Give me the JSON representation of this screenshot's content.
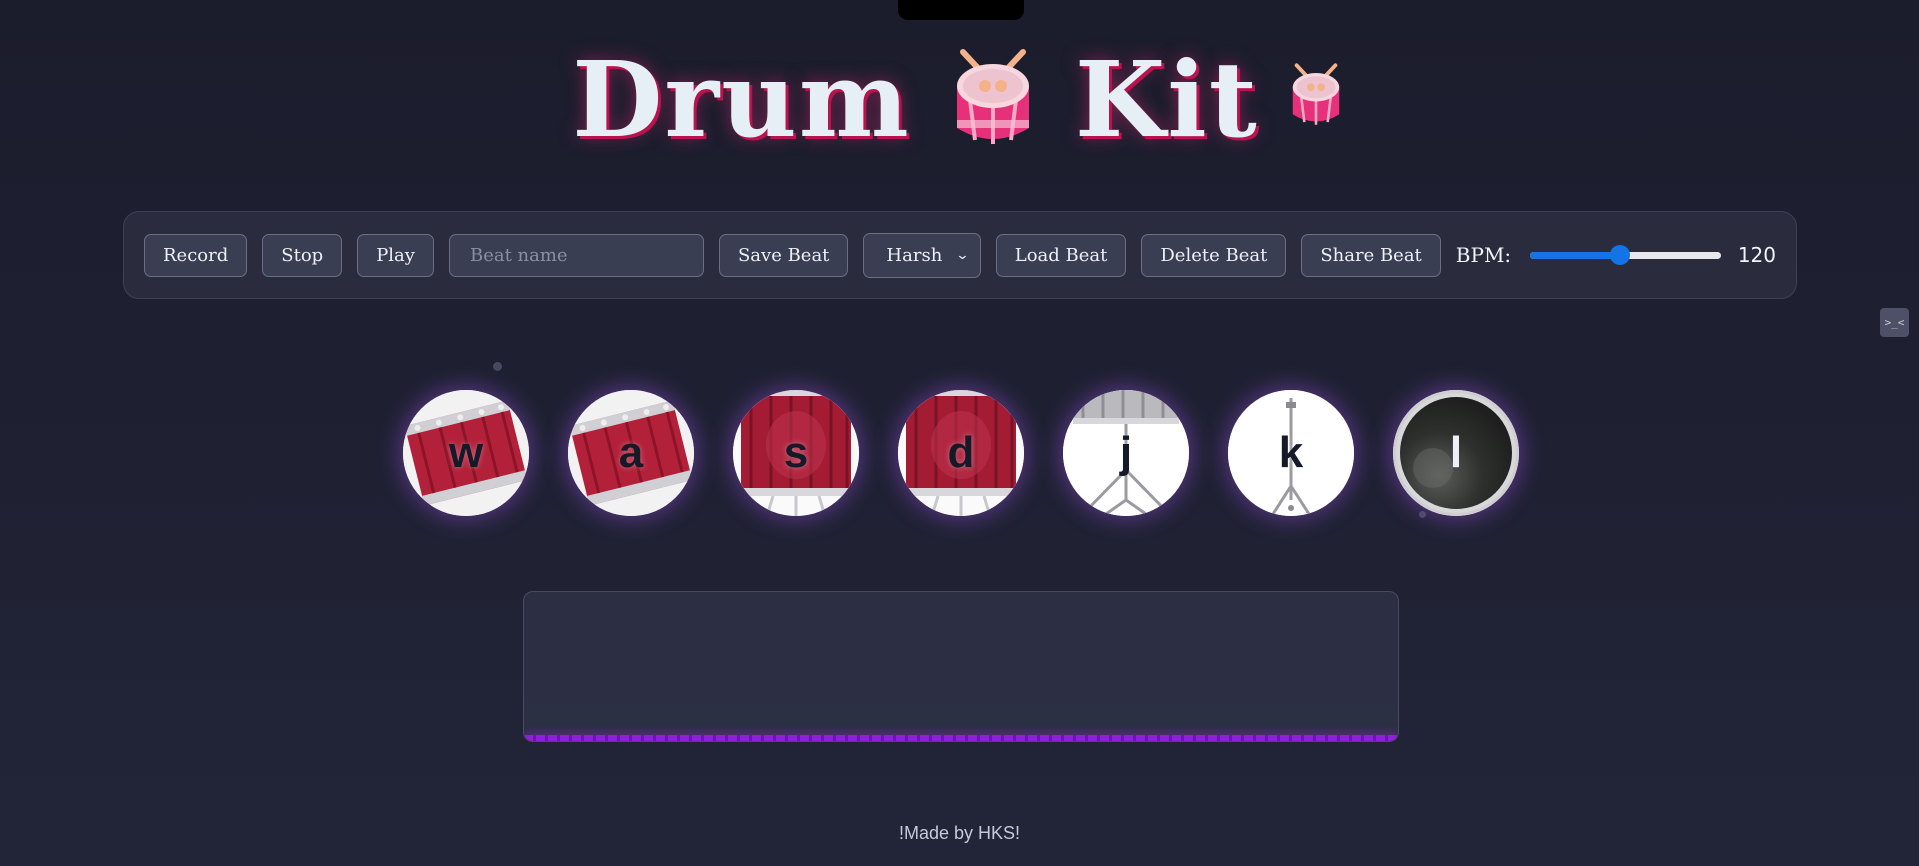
{
  "header": {
    "title_word1": "Drum",
    "title_word2": "Kit",
    "title_icon": "drum-icon"
  },
  "toolbar": {
    "record_label": "Record",
    "stop_label": "Stop",
    "play_label": "Play",
    "beat_name_placeholder": "Beat name",
    "beat_name_value": "",
    "save_label": "Save Beat",
    "kit_select_value": "Harsh",
    "load_label": "Load Beat",
    "delete_label": "Delete Beat",
    "share_label": "Share Beat",
    "bpm_label": "BPM:",
    "bpm_value": "120",
    "bpm_slider_fraction": 0.47
  },
  "pads": [
    {
      "key": "w",
      "sound": "tom-1",
      "icon": "tom-drum-icon"
    },
    {
      "key": "a",
      "sound": "tom-2",
      "icon": "tom-drum-icon"
    },
    {
      "key": "s",
      "sound": "tom-3",
      "icon": "floor-tom-icon"
    },
    {
      "key": "d",
      "sound": "tom-4",
      "icon": "floor-tom-icon"
    },
    {
      "key": "j",
      "sound": "snare",
      "icon": "snare-stand-icon"
    },
    {
      "key": "k",
      "sound": "hi-hat",
      "icon": "cymbal-stand-icon"
    },
    {
      "key": "l",
      "sound": "kick",
      "icon": "bass-drum-icon"
    }
  ],
  "footer": {
    "credit": "!Made by HKS!"
  },
  "colors": {
    "background": "#1f2133",
    "accent_pink": "#b9124f",
    "drum_red": "#b3203a",
    "slider_blue": "#1473e6",
    "display_bar_purple": "#8f1fdc",
    "pad_glow": "#9650dc"
  }
}
